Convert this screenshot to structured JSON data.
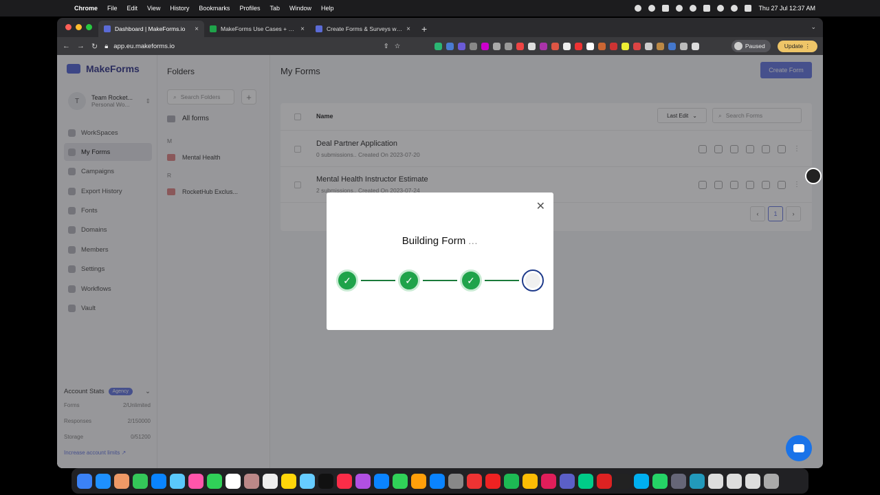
{
  "menubar": {
    "app": "Chrome",
    "menus": [
      "File",
      "Edit",
      "View",
      "History",
      "Bookmarks",
      "Profiles",
      "Tab",
      "Window",
      "Help"
    ],
    "clock": "Thu 27 Jul  12:37 AM"
  },
  "browser": {
    "tabs": [
      {
        "label": "Dashboard | MakeForms.io",
        "color": "#5b6bd6",
        "active": true
      },
      {
        "label": "MakeForms Use Cases + Examples",
        "color": "#1fa34a",
        "active": false
      },
      {
        "label": "Create Forms & Surveys with M",
        "color": "#5b6bd6",
        "active": false
      }
    ],
    "url": "app.eu.makeforms.io",
    "paused_label": "Paused",
    "update_label": "Update"
  },
  "sidebar": {
    "logo": "MakeForms",
    "team_initial": "T",
    "team_name": "Team Rocket...",
    "team_workspace": "Personal Wo...",
    "nav": [
      {
        "label": "WorkSpaces",
        "icon": "workspaces-icon",
        "active": false
      },
      {
        "label": "My Forms",
        "icon": "home-icon",
        "active": true
      },
      {
        "label": "Campaigns",
        "icon": "campaign-icon",
        "active": false
      },
      {
        "label": "Export History",
        "icon": "history-icon",
        "active": false
      },
      {
        "label": "Fonts",
        "icon": "fonts-icon",
        "active": false
      },
      {
        "label": "Domains",
        "icon": "globe-icon",
        "active": false
      },
      {
        "label": "Members",
        "icon": "members-icon",
        "active": false
      },
      {
        "label": "Settings",
        "icon": "gear-icon",
        "active": false
      },
      {
        "label": "Workflows",
        "icon": "workflow-icon",
        "active": false
      },
      {
        "label": "Vault",
        "icon": "shield-icon",
        "active": false
      }
    ],
    "stats": {
      "title": "Account Stats",
      "plan": "Agency",
      "rows": [
        {
          "label": "Forms",
          "value": "2/Unlimited"
        },
        {
          "label": "Responses",
          "value": "2/150000"
        },
        {
          "label": "Storage",
          "value": "0/51200"
        }
      ],
      "increase_label": "Increase account limits"
    }
  },
  "folders": {
    "title": "Folders",
    "search_placeholder": "Search Folders",
    "all_forms": "All forms",
    "groups": [
      {
        "letter": "M",
        "items": [
          "Mental Health"
        ]
      },
      {
        "letter": "R",
        "items": [
          "RocketHub Exclus..."
        ]
      }
    ]
  },
  "main": {
    "title": "My Forms",
    "create_label": "Create Form",
    "column_name": "Name",
    "sort_label": "Last Edit",
    "search_placeholder": "Search Forms",
    "rows": [
      {
        "title": "Deal Partner Application",
        "meta": "0 submissions.. Created On 2023-07-20"
      },
      {
        "title": "Mental Health Instructor Estimate",
        "meta": "2 submissions.. Created On 2023-07-24"
      }
    ],
    "page": "1"
  },
  "modal": {
    "title": "Building Form",
    "dots": "...",
    "steps_total": 4,
    "steps_done": 3,
    "done_color": "#1fa34a",
    "pending_color": "#1e3a8a"
  }
}
